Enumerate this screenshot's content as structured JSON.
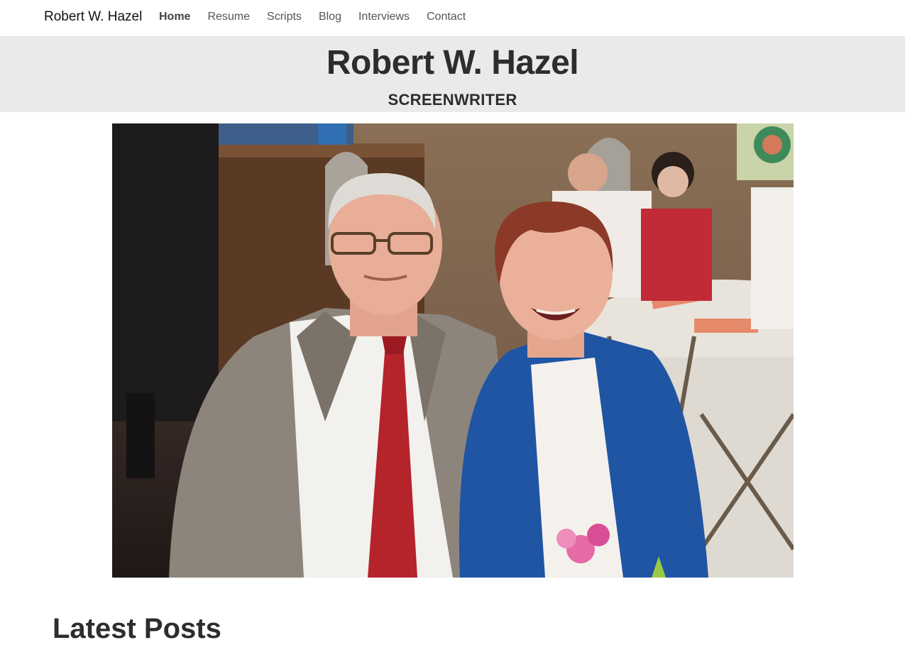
{
  "nav": {
    "brand": "Robert W. Hazel",
    "links": [
      {
        "label": "Home",
        "active": true
      },
      {
        "label": "Resume",
        "active": false
      },
      {
        "label": "Scripts",
        "active": false
      },
      {
        "label": "Blog",
        "active": false
      },
      {
        "label": "Interviews",
        "active": false
      },
      {
        "label": "Contact",
        "active": false
      }
    ]
  },
  "masthead": {
    "title": "Robert W. Hazel",
    "subtitle": "SCREENWRITER"
  },
  "hero": {
    "alt_semantic": "photo-of-couple-at-dinner-event"
  },
  "latest_posts": {
    "heading": "Latest Posts"
  },
  "colors": {
    "masthead_bg": "#eaeaea",
    "text": "#2d2d2d",
    "nav_text": "#555555"
  }
}
